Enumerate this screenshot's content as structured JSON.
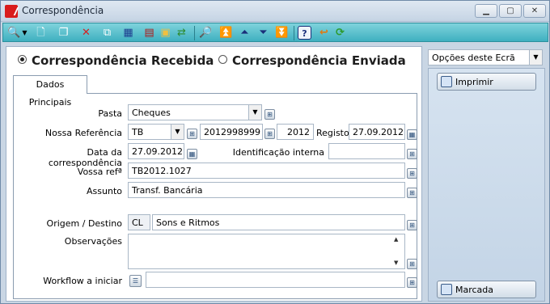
{
  "window": {
    "title": "Correspondência",
    "minimize": "▁",
    "maximize": "▢",
    "close": "✕"
  },
  "toolbar": {
    "icons": [
      "search-icon",
      "chevron-down-icon",
      "new-document-icon",
      "copy-document-icon",
      "delete-icon",
      "export-icon",
      "grid-icon",
      "print-icon",
      "folder-icon",
      "transfer-icon",
      "preview-icon",
      "first-record-icon",
      "prev-record-icon",
      "next-record-icon",
      "last-record-icon",
      "help-icon",
      "back-icon",
      "refresh-icon"
    ]
  },
  "direction": {
    "received_label": "Correspondência Recebida",
    "sent_label": "Correspondência Enviada",
    "selected": "received"
  },
  "tabs": [
    {
      "label": "Dados Principais",
      "active": true
    }
  ],
  "form": {
    "pasta_label": "Pasta",
    "pasta_value": "Cheques",
    "nossa_ref_label": "Nossa Referência",
    "nossa_ref_series": "TB",
    "nossa_ref_number": "2012998999",
    "nossa_ref_year": "2012",
    "registo_label": "Registo",
    "registo_value": "27.09.2012",
    "data_label": "Data da correspondência",
    "data_value": "27.09.2012",
    "ident_label": "Identificação interna",
    "ident_value": "",
    "vossa_ref_label": "Vossa refª",
    "vossa_ref_value": "TB2012.1027",
    "assunto_label": "Assunto",
    "assunto_value": "Transf. Bancária",
    "origem_label": "Origem / Destino",
    "origem_code": "CL",
    "origem_name": "Sons e Ritmos",
    "obs_label": "Observações",
    "obs_value": "",
    "workflow_label": "Workflow a iniciar",
    "workflow_value": ""
  },
  "side": {
    "options_label": "Opções deste Ecrã",
    "print_label": "Imprimir",
    "marked_label": "Marcada"
  }
}
